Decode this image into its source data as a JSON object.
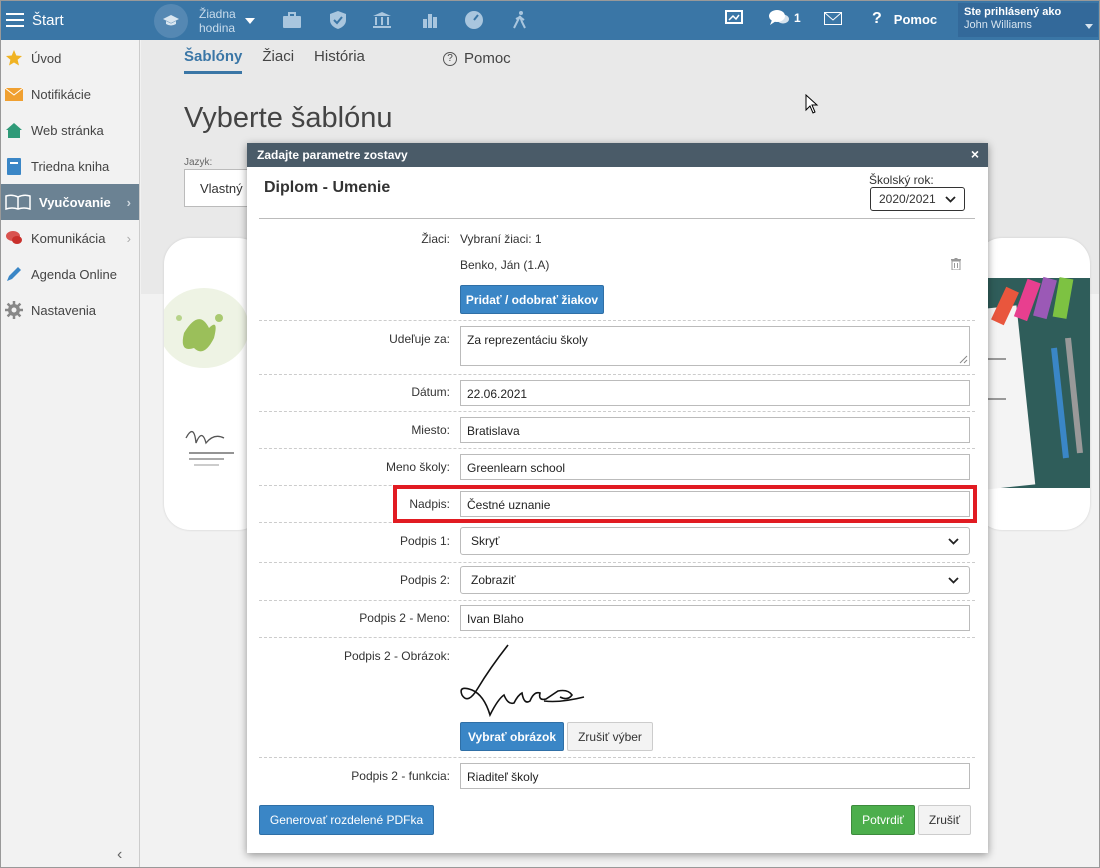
{
  "topbar": {
    "start_label": "Štart",
    "lesson_line1": "Žiadna",
    "lesson_line2": "hodina",
    "messages_count": "1",
    "help_label": "Pomoc",
    "user_line1": "Ste prihlásený ako",
    "user_name": "John Williams"
  },
  "sidebar": {
    "items": [
      {
        "label": "Úvod"
      },
      {
        "label": "Notifikácie"
      },
      {
        "label": "Web stránka"
      },
      {
        "label": "Triedna kniha"
      },
      {
        "label": "Vyučovanie"
      },
      {
        "label": "Komunikácia"
      },
      {
        "label": "Agenda Online"
      },
      {
        "label": "Nastavenia"
      }
    ]
  },
  "tabs": {
    "sablony": "Šablóny",
    "ziaci": "Žiaci",
    "historia": "História",
    "help": "Pomoc"
  },
  "page": {
    "title": "Vyberte šablónu",
    "lang_label": "Jazyk:",
    "lang_value": "Vlastný n"
  },
  "dialog": {
    "header": "Zadajte parametre zostavy",
    "close": "×",
    "title": "Diplom - Umenie",
    "year_label": "Školský rok:",
    "year_value": "2020/2021",
    "ziaci_label": "Žiaci:",
    "ziaci_selected": "Vybraní žiaci: 1",
    "student": "Benko, Ján (1.A)",
    "add_remove_btn": "Pridať / odobrať žiakov",
    "udeluje_label": "Udeľuje za:",
    "udeluje_value": "Za reprezentáciu školy",
    "datum_label": "Dátum:",
    "datum_value": "22.06.2021",
    "miesto_label": "Miesto:",
    "miesto_value": "Bratislava",
    "skola_label": "Meno školy:",
    "skola_value": "Greenlearn school",
    "nadpis_label": "Nadpis:",
    "nadpis_value": "Čestné uznanie",
    "podpis1_label": "Podpis 1:",
    "podpis1_value": "Skryť",
    "podpis2_label": "Podpis 2:",
    "podpis2_value": "Zobraziť",
    "podpis2_meno_label": "Podpis 2 - Meno:",
    "podpis2_meno_value": "Ivan Blaho",
    "podpis2_obrazok_label": "Podpis 2 - Obrázok:",
    "select_image_btn": "Vybrať obrázok",
    "cancel_selection_btn": "Zrušiť výber",
    "podpis2_funkcia_label": "Podpis 2 - funkcia:",
    "podpis2_funkcia_value": "Riaditeľ školy",
    "generate_btn": "Generovať rozdelené PDFka",
    "confirm_btn": "Potvrdiť",
    "cancel_btn": "Zrušiť"
  },
  "colors": {
    "topbar": "#3a76a6",
    "accent": "#3a86c6",
    "confirm": "#4cae4c",
    "highlight": "#e11b22"
  }
}
